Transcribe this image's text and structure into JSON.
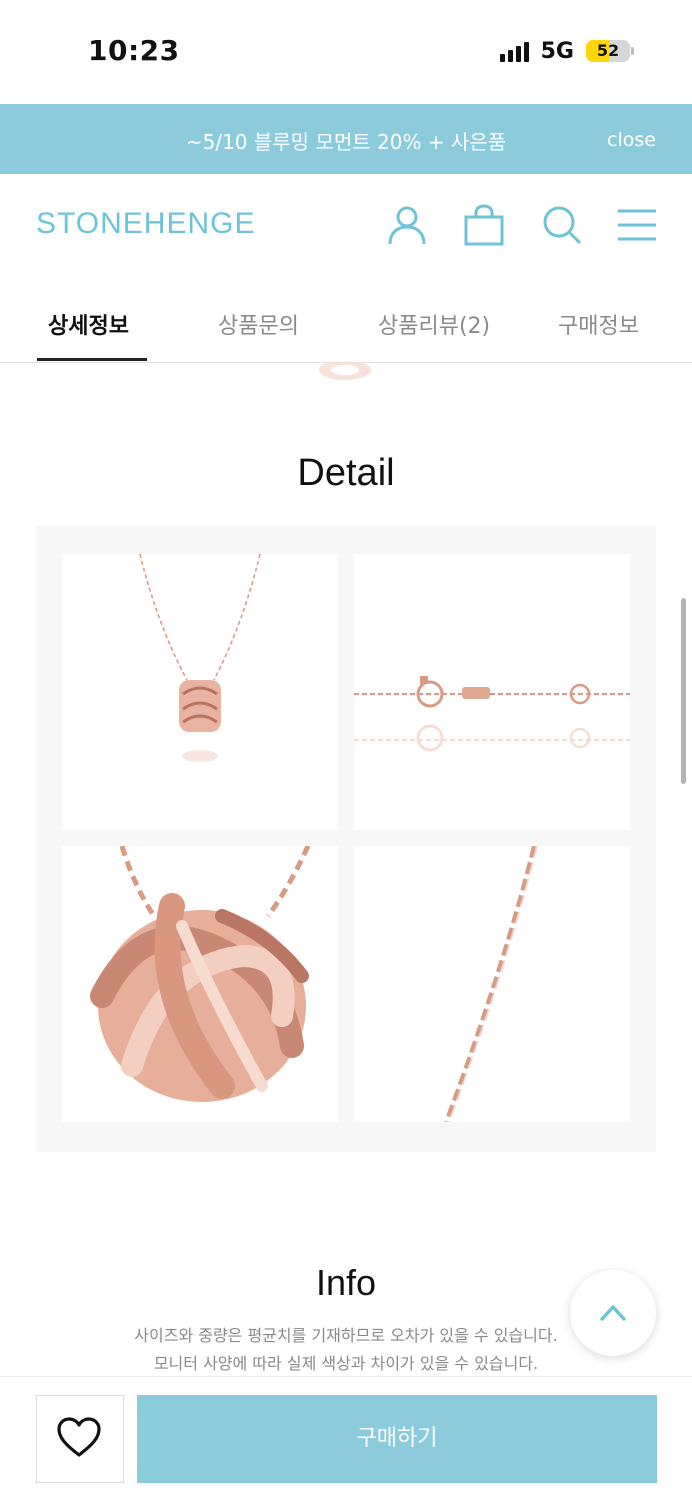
{
  "status_bar": {
    "time": "10:23",
    "network": "5G",
    "battery": "52",
    "battery_level": 0.52
  },
  "promo": {
    "text": "~5/10 블루밍 모먼트 20% + 사은품",
    "close_label": "close"
  },
  "header": {
    "logo": "STONEHENGE",
    "icons": [
      "account-icon",
      "shopping-bag-icon",
      "search-icon",
      "menu-icon"
    ]
  },
  "tabs": [
    {
      "label": "상세정보",
      "active": true
    },
    {
      "label": "상품문의",
      "active": false
    },
    {
      "label": "상품리뷰(2)",
      "active": false
    },
    {
      "label": "구매정보",
      "active": false
    }
  ],
  "detail": {
    "title": "Detail",
    "images": [
      "necklace-full",
      "chain-clasp",
      "pendant-closeup",
      "chain-closeup"
    ]
  },
  "info": {
    "title": "Info",
    "lines": [
      "사이즈와 중량은 평균치를 기재하므로 오차가 있을 수 있습니다.",
      "모니터 사양에 따라 실제 색상과 차이가 있을 수 있습니다."
    ]
  },
  "bottom_bar": {
    "buy_label": "구매하기"
  },
  "colors": {
    "brand": "#8ccbdc",
    "logo": "#6ec3d8",
    "rose_gold": "#d99a84"
  }
}
